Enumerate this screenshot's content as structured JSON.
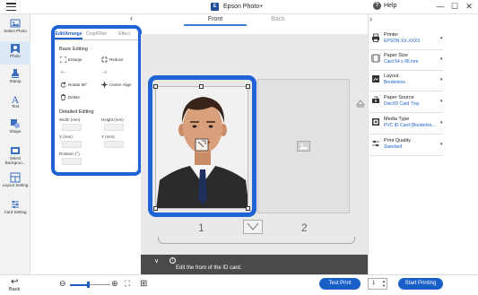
{
  "titlebar": {
    "app_title": "Epson Photo+",
    "help_label": "Help",
    "minimize": "—",
    "maximize": "☐",
    "close": "✕"
  },
  "leftnav": {
    "items": [
      {
        "label": "Select Photo",
        "icon": "gallery-icon"
      },
      {
        "label": "Photo",
        "icon": "person-photo-icon"
      },
      {
        "label": "Stamp",
        "icon": "stamp-icon"
      },
      {
        "label": "Text",
        "icon": "text-icon"
      },
      {
        "label": "Shape",
        "icon": "shape-icon"
      },
      {
        "label": "Select Backgrou...",
        "icon": "background-icon"
      },
      {
        "label": "Layout Setting",
        "icon": "layout-icon"
      },
      {
        "label": "Card Setting",
        "icon": "card-icon"
      }
    ]
  },
  "edit_panel": {
    "tabs": [
      "Edit/Arrange",
      "Crop/Filter",
      "Effect"
    ],
    "collapse": "‹",
    "basic_title": "Basic Editing",
    "tools": {
      "enlarge": "Enlarge",
      "reduce": "Reduce",
      "rotate": "Rotate 90°",
      "center_align": "Center Align",
      "delete": "Delete"
    },
    "detailed_title": "Detailed Editing",
    "fields": {
      "width_label": "Width (mm)",
      "height_label": "Height (mm)",
      "x_label": "X (mm)",
      "y_label": "Y (mm)",
      "rotation_label": "Rotation (°)",
      "width": "",
      "height": "",
      "x": "",
      "y": "",
      "rotation": ""
    }
  },
  "preview": {
    "tabs": {
      "front": "Front",
      "back": "Back"
    },
    "page1": "1",
    "page2": "2",
    "info_chevron": "∨",
    "info_icon": "i",
    "info_text": "Edit the front of the ID card."
  },
  "settings": {
    "collapse": "›",
    "items": [
      {
        "title": "Printer",
        "value": "EPSON XX-XXXX",
        "icon": "printer-icon"
      },
      {
        "title": "Paper Size",
        "value": "Card 54 x 86 mm",
        "icon": "paper-size-icon"
      },
      {
        "title": "Layout",
        "value": "Borderless",
        "icon": "layout-icon"
      },
      {
        "title": "Paper Source",
        "value": "Disc/ID Card Tray",
        "icon": "paper-source-icon"
      },
      {
        "title": "Media Type",
        "value": "PVC ID Card (Borderles...",
        "icon": "media-type-icon"
      },
      {
        "title": "Print Quality",
        "value": "Standard",
        "icon": "print-quality-icon"
      }
    ],
    "arrow": "▾"
  },
  "bottombar": {
    "back_icon": "↩",
    "back_label": "Back",
    "zoom_out": "⊖",
    "zoom_in": "⊕",
    "zoom_level": 0.45,
    "fit": "⛶",
    "grid": "⊞",
    "test_print": "Test Print",
    "copies": "1",
    "start_printing": "Start Printing"
  },
  "colors": {
    "accent": "#1a5fc8",
    "highlight": "#1f63d6",
    "info_bar": "#4a4a4a"
  }
}
